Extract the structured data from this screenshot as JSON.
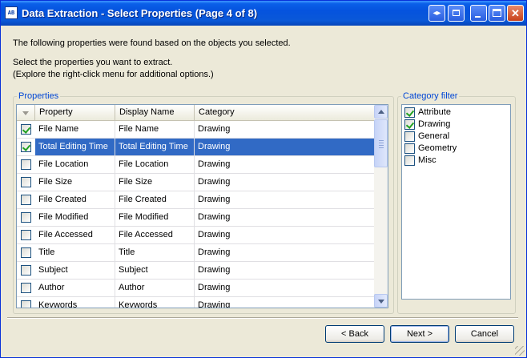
{
  "window": {
    "title": "Data Extraction - Select Properties (Page 4 of 8)",
    "app_icon_text": "AB"
  },
  "title_buttons": {
    "close": "✕"
  },
  "intro": {
    "line1": "The following properties were found based on the objects you selected.",
    "line2": "Select the properties you want to extract.",
    "line3": "(Explore the right-click menu for additional options.)"
  },
  "properties": {
    "legend": "Properties",
    "columns": [
      "Property",
      "Display Name",
      "Category"
    ],
    "rows": [
      {
        "checked": true,
        "selected": false,
        "property": "File Name",
        "display": "File Name",
        "category": "Drawing"
      },
      {
        "checked": true,
        "selected": true,
        "property": "Total Editing Time",
        "display": "Total Editing Time",
        "category": "Drawing"
      },
      {
        "checked": false,
        "selected": false,
        "property": "File Location",
        "display": "File Location",
        "category": "Drawing"
      },
      {
        "checked": false,
        "selected": false,
        "property": "File Size",
        "display": "File Size",
        "category": "Drawing"
      },
      {
        "checked": false,
        "selected": false,
        "property": "File Created",
        "display": "File Created",
        "category": "Drawing"
      },
      {
        "checked": false,
        "selected": false,
        "property": "File Modified",
        "display": "File Modified",
        "category": "Drawing"
      },
      {
        "checked": false,
        "selected": false,
        "property": "File Accessed",
        "display": "File Accessed",
        "category": "Drawing"
      },
      {
        "checked": false,
        "selected": false,
        "property": "Title",
        "display": "Title",
        "category": "Drawing"
      },
      {
        "checked": false,
        "selected": false,
        "property": "Subject",
        "display": "Subject",
        "category": "Drawing"
      },
      {
        "checked": false,
        "selected": false,
        "property": "Author",
        "display": "Author",
        "category": "Drawing"
      },
      {
        "checked": false,
        "selected": false,
        "property": "Keywords",
        "display": "Keywords",
        "category": "Drawing"
      }
    ]
  },
  "category_filter": {
    "legend": "Category filter",
    "items": [
      {
        "label": "Attribute",
        "checked": true
      },
      {
        "label": "Drawing",
        "checked": true
      },
      {
        "label": "General",
        "checked": false
      },
      {
        "label": "Geometry",
        "checked": false
      },
      {
        "label": "Misc",
        "checked": false
      }
    ]
  },
  "buttons": {
    "back": "< Back",
    "next": "Next >",
    "cancel": "Cancel"
  },
  "colors": {
    "selection": "#316ac5",
    "accent_legend": "#0046d5",
    "check": "#21a121"
  }
}
